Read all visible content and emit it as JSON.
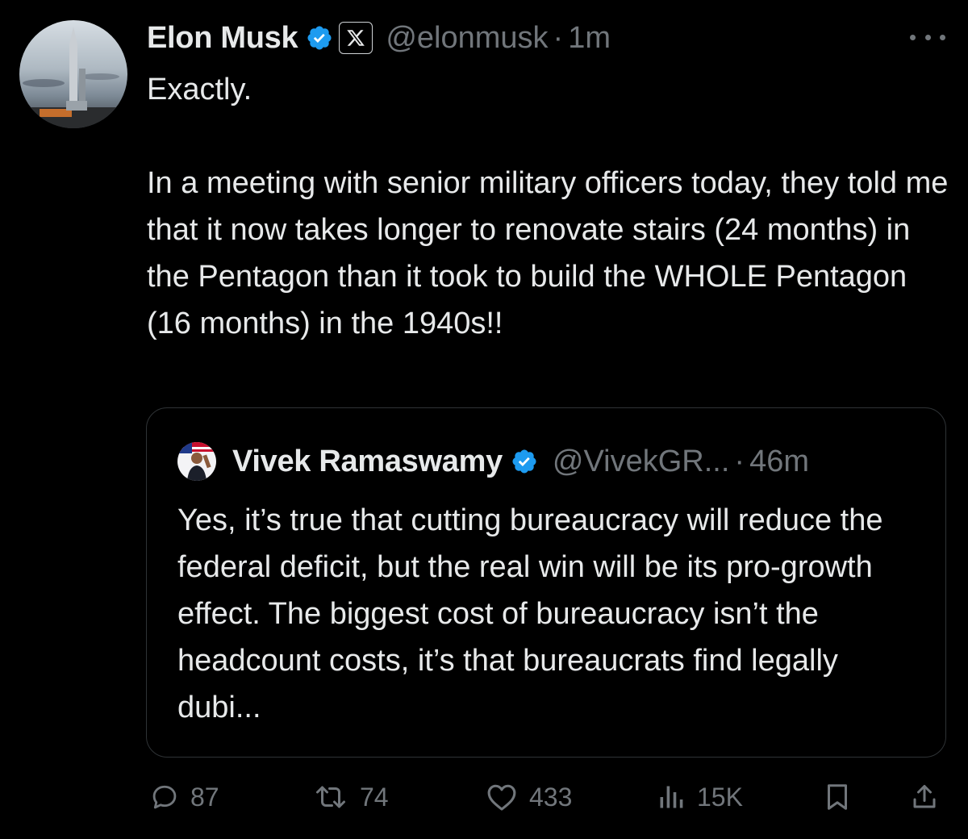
{
  "tweet": {
    "author_name": "Elon Musk",
    "author_handle": "@elonmusk",
    "separator": "·",
    "time": "1m",
    "body": [
      "Exactly.",
      "In a meeting with senior military officers today, they told me that it now takes longer to renovate stairs (24 months) in the Pentagon than it took to build the WHOLE Pentagon (16 months) in the 1940s!!"
    ],
    "affiliation_badge": "X"
  },
  "quote": {
    "author_name": "Vivek Ramaswamy",
    "author_handle": "@VivekGR...",
    "separator": "·",
    "time": "46m",
    "text": "Yes, it’s true that cutting bureaucracy will reduce the federal deficit, but the real win will be its pro-growth effect. The biggest cost of bureaucracy isn’t the headcount costs, it’s that bureaucrats find legally dubi..."
  },
  "actions": {
    "replies": "87",
    "reposts": "74",
    "likes": "433",
    "views": "15K"
  },
  "colors": {
    "background": "#000000",
    "text": "#e7e9ea",
    "muted": "#71767b",
    "verified": "#1d9bf0",
    "border": "#2f3336"
  },
  "icons": [
    "verified-badge-icon",
    "x-logo-icon",
    "more-icon",
    "reply-icon",
    "repost-icon",
    "like-icon",
    "views-icon",
    "bookmark-icon",
    "share-icon"
  ]
}
